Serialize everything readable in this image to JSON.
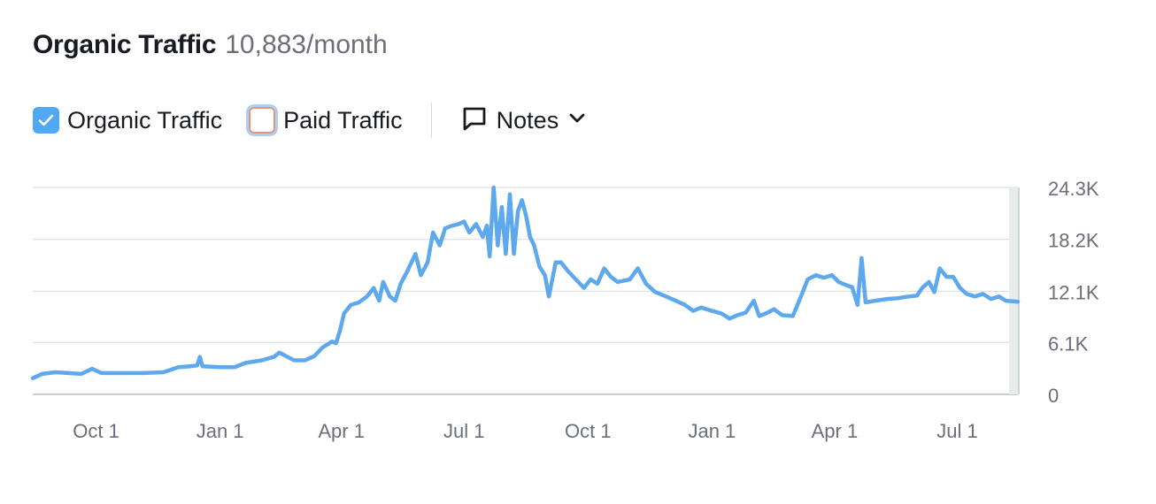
{
  "header": {
    "title": "Organic Traffic",
    "subtitle": "10,883/month"
  },
  "legend": {
    "organic_label": "Organic Traffic",
    "paid_label": "Paid Traffic",
    "organic_checked": true,
    "paid_checked": false,
    "notes_label": "Notes"
  },
  "icons": {
    "checkbox": "check-icon",
    "notes": "comment-icon",
    "dropdown": "chevron-down-icon"
  },
  "colors": {
    "organic_line": "#5ea8ee",
    "paid_outline": "#e89772",
    "grid": "#e0e1e5",
    "axis_text": "#6c6e79"
  },
  "chart_data": {
    "type": "line",
    "x_range": [
      "2022-08-15",
      "2024-08-15"
    ],
    "x_ticks": [
      {
        "date": "2022-10-01",
        "label": "Oct 1"
      },
      {
        "date": "2023-01-01",
        "label": "Jan 1"
      },
      {
        "date": "2023-04-01",
        "label": "Apr 1"
      },
      {
        "date": "2023-07-01",
        "label": "Jul 1"
      },
      {
        "date": "2023-10-01",
        "label": "Oct 1"
      },
      {
        "date": "2024-01-01",
        "label": "Jan 1"
      },
      {
        "date": "2024-04-01",
        "label": "Apr 1"
      },
      {
        "date": "2024-07-01",
        "label": "Jul 1"
      }
    ],
    "y_ticks": [
      {
        "value": 0,
        "label": "0"
      },
      {
        "value": 6100,
        "label": "6.1K"
      },
      {
        "value": 12100,
        "label": "12.1K"
      },
      {
        "value": 18200,
        "label": "18.2K"
      },
      {
        "value": 24300,
        "label": "24.3K"
      }
    ],
    "ylim": [
      0,
      24300
    ],
    "grid": true,
    "series": [
      {
        "name": "Organic Traffic",
        "points": [
          [
            "2022-08-15",
            1900
          ],
          [
            "2022-08-22",
            2400
          ],
          [
            "2022-09-01",
            2600
          ],
          [
            "2022-09-10",
            2500
          ],
          [
            "2022-09-20",
            2400
          ],
          [
            "2022-09-28",
            3000
          ],
          [
            "2022-10-05",
            2500
          ],
          [
            "2022-10-20",
            2500
          ],
          [
            "2022-11-05",
            2500
          ],
          [
            "2022-11-20",
            2600
          ],
          [
            "2022-12-01",
            3200
          ],
          [
            "2022-12-10",
            3300
          ],
          [
            "2022-12-15",
            3400
          ],
          [
            "2022-12-17",
            4400
          ],
          [
            "2022-12-19",
            3300
          ],
          [
            "2023-01-01",
            3200
          ],
          [
            "2023-01-12",
            3200
          ],
          [
            "2023-01-20",
            3700
          ],
          [
            "2023-02-01",
            4000
          ],
          [
            "2023-02-10",
            4400
          ],
          [
            "2023-02-14",
            4900
          ],
          [
            "2023-02-20",
            4400
          ],
          [
            "2023-02-25",
            4000
          ],
          [
            "2023-03-05",
            4000
          ],
          [
            "2023-03-12",
            4500
          ],
          [
            "2023-03-18",
            5500
          ],
          [
            "2023-03-25",
            6200
          ],
          [
            "2023-03-28",
            6000
          ],
          [
            "2023-03-31",
            7500
          ],
          [
            "2023-04-03",
            9500
          ],
          [
            "2023-04-08",
            10500
          ],
          [
            "2023-04-14",
            10800
          ],
          [
            "2023-04-20",
            11500
          ],
          [
            "2023-04-25",
            12500
          ],
          [
            "2023-04-29",
            11000
          ],
          [
            "2023-05-02",
            13200
          ],
          [
            "2023-05-07",
            11500
          ],
          [
            "2023-05-11",
            11000
          ],
          [
            "2023-05-15",
            13000
          ],
          [
            "2023-05-20",
            14500
          ],
          [
            "2023-05-26",
            16500
          ],
          [
            "2023-05-30",
            14000
          ],
          [
            "2023-06-04",
            15500
          ],
          [
            "2023-06-08",
            19000
          ],
          [
            "2023-06-13",
            17500
          ],
          [
            "2023-06-17",
            19500
          ],
          [
            "2023-06-22",
            19800
          ],
          [
            "2023-06-27",
            20000
          ],
          [
            "2023-07-01",
            20300
          ],
          [
            "2023-07-05",
            19000
          ],
          [
            "2023-07-10",
            20000
          ],
          [
            "2023-07-15",
            18500
          ],
          [
            "2023-07-18",
            19800
          ],
          [
            "2023-07-20",
            16200
          ],
          [
            "2023-07-23",
            24300
          ],
          [
            "2023-07-26",
            17500
          ],
          [
            "2023-07-29",
            22000
          ],
          [
            "2023-08-01",
            16500
          ],
          [
            "2023-08-04",
            23500
          ],
          [
            "2023-08-07",
            16500
          ],
          [
            "2023-08-10",
            21500
          ],
          [
            "2023-08-13",
            22800
          ],
          [
            "2023-08-16",
            21000
          ],
          [
            "2023-08-19",
            18500
          ],
          [
            "2023-08-22",
            17500
          ],
          [
            "2023-08-26",
            15000
          ],
          [
            "2023-08-30",
            14000
          ],
          [
            "2023-09-02",
            11500
          ],
          [
            "2023-09-07",
            15500
          ],
          [
            "2023-09-11",
            15500
          ],
          [
            "2023-09-16",
            14500
          ],
          [
            "2023-09-22",
            13500
          ],
          [
            "2023-09-28",
            12500
          ],
          [
            "2023-10-03",
            13500
          ],
          [
            "2023-10-08",
            13000
          ],
          [
            "2023-10-13",
            14800
          ],
          [
            "2023-10-18",
            13800
          ],
          [
            "2023-10-23",
            13200
          ],
          [
            "2023-11-01",
            13500
          ],
          [
            "2023-11-07",
            14800
          ],
          [
            "2023-11-13",
            13000
          ],
          [
            "2023-11-20",
            12000
          ],
          [
            "2023-11-28",
            11500
          ],
          [
            "2023-12-05",
            11000
          ],
          [
            "2023-12-12",
            10500
          ],
          [
            "2023-12-18",
            9800
          ],
          [
            "2023-12-24",
            10200
          ],
          [
            "2024-01-01",
            9800
          ],
          [
            "2024-01-08",
            9500
          ],
          [
            "2024-01-14",
            8900
          ],
          [
            "2024-01-20",
            9300
          ],
          [
            "2024-01-26",
            9600
          ],
          [
            "2024-02-01",
            11000
          ],
          [
            "2024-02-05",
            9200
          ],
          [
            "2024-02-10",
            9500
          ],
          [
            "2024-02-16",
            10000
          ],
          [
            "2024-02-22",
            9300
          ],
          [
            "2024-03-01",
            9200
          ],
          [
            "2024-03-07",
            11500
          ],
          [
            "2024-03-12",
            13500
          ],
          [
            "2024-03-18",
            14000
          ],
          [
            "2024-03-24",
            13700
          ],
          [
            "2024-03-30",
            14000
          ],
          [
            "2024-04-04",
            13200
          ],
          [
            "2024-04-10",
            12800
          ],
          [
            "2024-04-14",
            12600
          ],
          [
            "2024-04-18",
            10500
          ],
          [
            "2024-04-21",
            16000
          ],
          [
            "2024-04-24",
            10800
          ],
          [
            "2024-05-01",
            11000
          ],
          [
            "2024-05-10",
            11200
          ],
          [
            "2024-05-18",
            11300
          ],
          [
            "2024-05-26",
            11500
          ],
          [
            "2024-06-01",
            11600
          ],
          [
            "2024-06-05",
            12500
          ],
          [
            "2024-06-10",
            13200
          ],
          [
            "2024-06-14",
            12000
          ],
          [
            "2024-06-18",
            14800
          ],
          [
            "2024-06-23",
            13800
          ],
          [
            "2024-06-28",
            13800
          ],
          [
            "2024-07-03",
            12500
          ],
          [
            "2024-07-08",
            11800
          ],
          [
            "2024-07-14",
            11500
          ],
          [
            "2024-07-20",
            11800
          ],
          [
            "2024-07-26",
            11200
          ],
          [
            "2024-08-01",
            11500
          ],
          [
            "2024-08-06",
            11000
          ],
          [
            "2024-08-15",
            10883
          ]
        ]
      }
    ]
  }
}
